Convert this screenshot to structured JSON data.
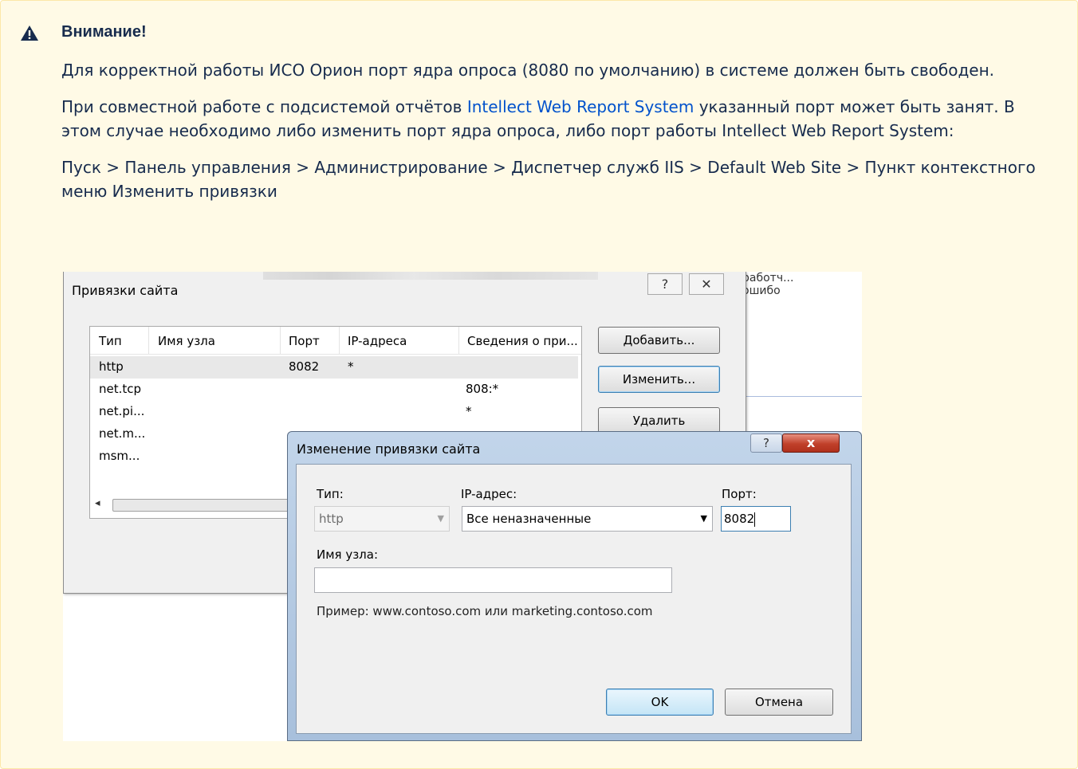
{
  "note": {
    "icon": "warning-icon",
    "title": "Внимание!",
    "paragraph1": "Для корректной работы ИСО Орион порт ядра опроса (8080 по умолчанию) в системе должен быть свободен.",
    "paragraph2_before": "При совместной работе с подсистемой отчётов ",
    "paragraph2_link": "Intellect Web Report System",
    "paragraph2_after": " указанный порт может быть занят. В этом случае необходимо либо изменить порт ядра опроса, либо порт работы Intellect Web Report System:",
    "paragraph3": "Пуск > Панель управления > Администрирование > Диспетчер служб IIS > Default Web Site > Пункт контекстного меню Изменить привязки"
  },
  "background": {
    "col1": "работч...",
    "col2": "ошибо"
  },
  "site_bindings": {
    "title": "Привязки сайта",
    "help": "?",
    "close": "✕",
    "columns": [
      "Тип",
      "Имя узла",
      "Порт",
      "IP-адреса",
      "Сведения о при..."
    ],
    "rows": [
      {
        "type": "http",
        "host": "",
        "port": "8082",
        "ip": "*",
        "info": ""
      },
      {
        "type": "net.tcp",
        "host": "",
        "port": "",
        "ip": "",
        "info": "808:*"
      },
      {
        "type": "net.pi...",
        "host": "",
        "port": "",
        "ip": "",
        "info": "*"
      },
      {
        "type": "net.m...",
        "host": "",
        "port": "",
        "ip": "",
        "info": ""
      },
      {
        "type": "msm...",
        "host": "",
        "port": "",
        "ip": "",
        "info": ""
      }
    ],
    "buttons": {
      "add": "Добавить...",
      "edit": "Изменить...",
      "delete": "Удалить"
    }
  },
  "edit_binding": {
    "title": "Изменение привязки сайта",
    "help": "?",
    "close": "x",
    "type_label": "Тип:",
    "type_value": "http",
    "ip_label": "IP-адрес:",
    "ip_value": "Все неназначенные",
    "port_label": "Порт:",
    "port_value": "8082",
    "host_label": "Имя узла:",
    "host_value": "",
    "example": "Пример: www.contoso.com или marketing.contoso.com",
    "ok": "OK",
    "cancel": "Отмена"
  }
}
